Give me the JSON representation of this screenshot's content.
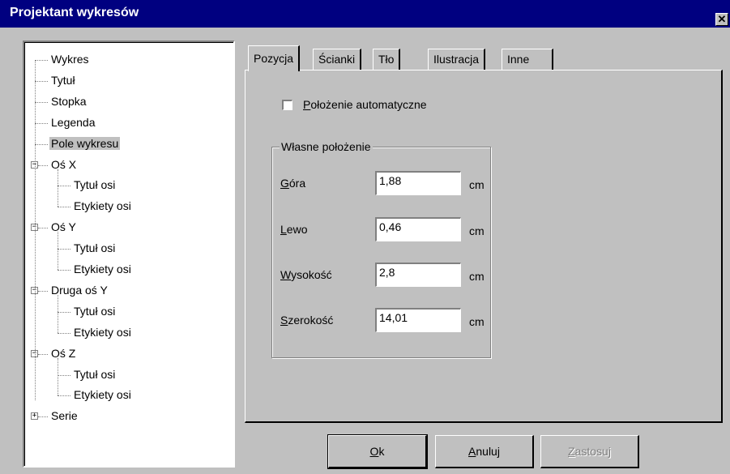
{
  "window": {
    "title": "Projektant wykresów",
    "close_glyph": "✕"
  },
  "tree": {
    "nodes": [
      {
        "label": "Wykres"
      },
      {
        "label": "Tytuł"
      },
      {
        "label": "Stopka"
      },
      {
        "label": "Legenda"
      },
      {
        "label": "Pole wykresu",
        "selected": true
      },
      {
        "label": "Oś X",
        "expander": "−"
      },
      {
        "label": "Tytuł osi"
      },
      {
        "label": "Etykiety osi"
      },
      {
        "label": "Oś Y",
        "expander": "−"
      },
      {
        "label": "Tytuł osi"
      },
      {
        "label": "Etykiety osi"
      },
      {
        "label": "Druga oś Y",
        "expander": "−"
      },
      {
        "label": "Tytuł osi"
      },
      {
        "label": "Etykiety osi"
      },
      {
        "label": "Oś Z",
        "expander": "−"
      },
      {
        "label": "Tytuł osi"
      },
      {
        "label": "Etykiety osi"
      },
      {
        "label": "Serie",
        "expander": "+"
      }
    ]
  },
  "tabs": [
    {
      "label": "Pozycja",
      "active": true
    },
    {
      "label": "Ścianki"
    },
    {
      "label": "Tło"
    },
    {
      "label": "Ilustracja"
    },
    {
      "label": "Inne"
    }
  ],
  "position": {
    "auto_label_u": "P",
    "auto_label_rest": "ołożenie automatyczne",
    "auto_checked": false,
    "group_title": "Własne położenie",
    "fields": [
      {
        "label_u": "G",
        "label_rest": "óra",
        "value": "1,88",
        "unit": "cm"
      },
      {
        "label_u": "L",
        "label_rest": "ewo",
        "value": "0,46",
        "unit": "cm"
      },
      {
        "label_u": "W",
        "label_rest": "ysokość",
        "value": "2,8",
        "unit": "cm"
      },
      {
        "label_u": "S",
        "label_rest": "zerokość",
        "value": "14,01",
        "unit": "cm"
      }
    ]
  },
  "buttons": {
    "ok_u": "O",
    "ok_rest": "k",
    "cancel_u": "A",
    "cancel_rest": "nuluj",
    "apply_u": "Z",
    "apply_rest": "astosuj"
  }
}
